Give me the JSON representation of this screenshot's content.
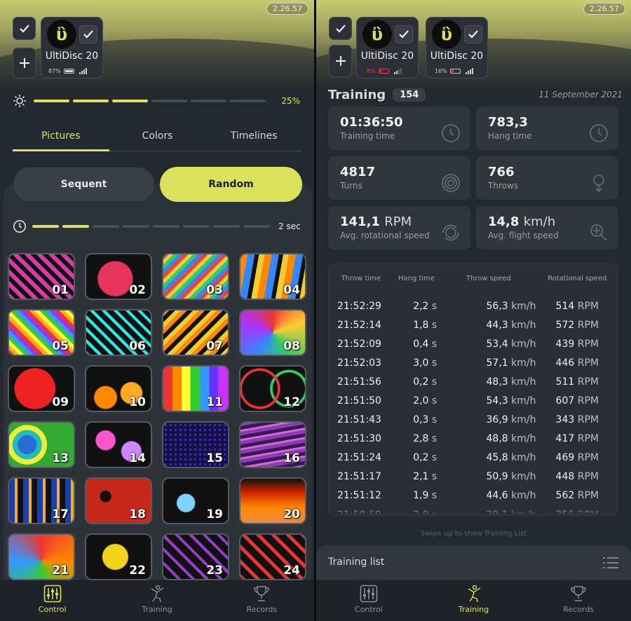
{
  "app": {
    "version": "2.26.57",
    "accent": "#dbe15c"
  },
  "left": {
    "device": {
      "name": "UltiDisc 20",
      "battery": "87%"
    },
    "brightness": {
      "value_label": "25%",
      "level": 0.25
    },
    "tabs": [
      "Pictures",
      "Colors",
      "Timelines"
    ],
    "active_tab": "Pictures",
    "mode": {
      "sequent": "Sequent",
      "random": "Random",
      "selected": "Random"
    },
    "timer": {
      "value_label": "2 sec"
    },
    "pictures": [
      "01",
      "02",
      "03",
      "04",
      "05",
      "06",
      "07",
      "08",
      "09",
      "10",
      "11",
      "12",
      "13",
      "14",
      "15",
      "16",
      "17",
      "18",
      "19",
      "20",
      "21",
      "22",
      "23",
      "24"
    ]
  },
  "right": {
    "devices": [
      {
        "name": "UltiDisc 20",
        "battery": "8%",
        "battery_color": "#e0405a"
      },
      {
        "name": "UltiDisc 20",
        "battery": "16%",
        "battery_color": "#e0405a"
      }
    ],
    "training": {
      "title": "Training",
      "count": "154",
      "date": "11 September 2021"
    },
    "stats": [
      {
        "value": "01:36:50",
        "unit": "",
        "label": "Training time",
        "icon": "clock-icon"
      },
      {
        "value": "783,3",
        "unit": "",
        "label": "Hang time",
        "icon": "clock-icon"
      },
      {
        "value": "4817",
        "unit": "",
        "label": "Turns",
        "icon": "target-icon"
      },
      {
        "value": "766",
        "unit": "",
        "label": "Throws",
        "icon": "pin-icon"
      },
      {
        "value": "141,1",
        "unit": "RPM",
        "label": "Avg. rotational speed",
        "icon": "spin-icon"
      },
      {
        "value": "14,8",
        "unit": "km/h",
        "label": "Avg. flight speed",
        "icon": "speed-icon"
      }
    ],
    "table": {
      "headers": [
        "Throw time",
        "Hang time",
        "Throw speed",
        "Rotational speed"
      ],
      "units": {
        "hang": "s",
        "speed": "km/h",
        "rot": "RPM"
      },
      "rows": [
        [
          "21:52:29",
          "2,2",
          "56,3",
          "514"
        ],
        [
          "21:52:14",
          "1,8",
          "44,3",
          "572"
        ],
        [
          "21:52:09",
          "0,4",
          "53,4",
          "439"
        ],
        [
          "21:52:03",
          "3,0",
          "57,1",
          "446"
        ],
        [
          "21:51:56",
          "0,2",
          "48,3",
          "511"
        ],
        [
          "21:51:50",
          "2,0",
          "54,3",
          "607"
        ],
        [
          "21:51:43",
          "0,3",
          "36,9",
          "343"
        ],
        [
          "21:51:30",
          "2,8",
          "48,8",
          "417"
        ],
        [
          "21:51:24",
          "0,2",
          "45,8",
          "469"
        ],
        [
          "21:51:17",
          "2,1",
          "50,9",
          "448"
        ],
        [
          "21:51:12",
          "1,9",
          "44,6",
          "562"
        ],
        [
          "21:50:59",
          "2,0",
          "39,1",
          "355"
        ]
      ]
    },
    "swipe_hint": "Swipe up to show Training List",
    "training_list": "Training list"
  },
  "nav": {
    "control": "Control",
    "training": "Training",
    "records": "Records"
  }
}
